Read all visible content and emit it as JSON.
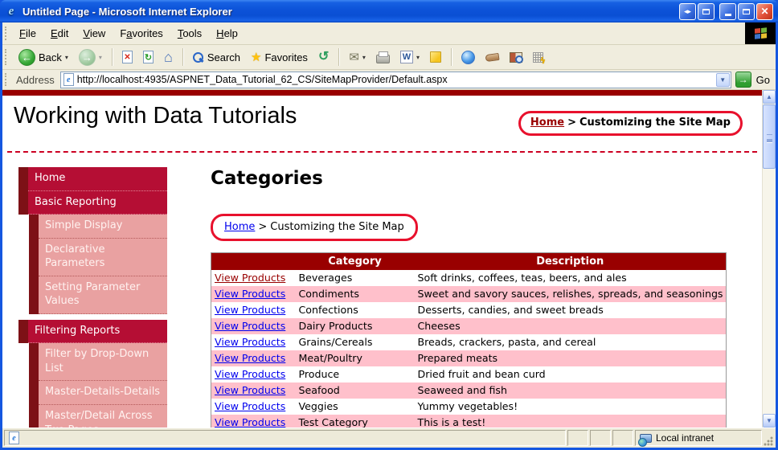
{
  "window": {
    "title": "Untitled Page - Microsoft Internet Explorer"
  },
  "menu_bar": {
    "items": [
      {
        "pre": "",
        "key": "F",
        "post": "ile"
      },
      {
        "pre": "",
        "key": "E",
        "post": "dit"
      },
      {
        "pre": "",
        "key": "V",
        "post": "iew"
      },
      {
        "pre": "F",
        "key": "a",
        "post": "vorites"
      },
      {
        "pre": "",
        "key": "T",
        "post": "ools"
      },
      {
        "pre": "",
        "key": "H",
        "post": "elp"
      }
    ]
  },
  "toolbar": {
    "back_label": "Back",
    "search_label": "Search",
    "favorites_label": "Favorites"
  },
  "address_bar": {
    "label": "Address",
    "url": "http://localhost:4935/ASPNET_Data_Tutorial_62_CS/SiteMapProvider/Default.aspx",
    "go_label": "Go"
  },
  "icons": {
    "back_arrow": "←",
    "forward_arrow": "→",
    "dropdown": "▾",
    "stop": "✕",
    "refresh": "↻",
    "home": "⌂",
    "star": "★",
    "history": "↺",
    "mail": "✉",
    "word": "W",
    "lightning": "ϟ",
    "up": "▲",
    "down": "▼",
    "close": "✕",
    "resize_h": "◂▸",
    "go_arrow": "→",
    "ie_e": "e"
  },
  "page": {
    "header_title": "Working with Data Tutorials",
    "top_breadcrumb": {
      "home": "Home",
      "sep": ">",
      "current": "Customizing the Site Map"
    },
    "sidebar": {
      "items": [
        {
          "label": "Home",
          "level": 1
        },
        {
          "label": "Basic Reporting",
          "level": 1
        },
        {
          "label": "Simple Display",
          "level": 2
        },
        {
          "label": "Declarative Parameters",
          "level": 2
        },
        {
          "label": "Setting Parameter Values",
          "level": 2
        },
        {
          "label": "Filtering Reports",
          "level": 1,
          "gap_before": true
        },
        {
          "label": "Filter by Drop-Down List",
          "level": 2
        },
        {
          "label": "Master-Details-Details",
          "level": 2
        },
        {
          "label": "Master/Detail Across Two Pages",
          "level": 2
        },
        {
          "label": "",
          "level": 2,
          "cut": true
        }
      ]
    },
    "main": {
      "title": "Categories",
      "breadcrumb": {
        "home": "Home",
        "sep": ">",
        "current": "Customizing the Site Map"
      },
      "table": {
        "headers": [
          "",
          "Category",
          "Description"
        ],
        "link_label": "View Products",
        "rows": [
          {
            "category": "Beverages",
            "description": "Soft drinks, coffees, teas, beers, and ales",
            "visited": true
          },
          {
            "category": "Condiments",
            "description": "Sweet and savory sauces, relishes, spreads, and seasonings"
          },
          {
            "category": "Confections",
            "description": "Desserts, candies, and sweet breads"
          },
          {
            "category": "Dairy Products",
            "description": "Cheeses"
          },
          {
            "category": "Grains/Cereals",
            "description": "Breads, crackers, pasta, and cereal"
          },
          {
            "category": "Meat/Poultry",
            "description": "Prepared meats"
          },
          {
            "category": "Produce",
            "description": "Dried fruit and bean curd"
          },
          {
            "category": "Seafood",
            "description": "Seaweed and fish"
          },
          {
            "category": "Veggies",
            "description": "Yummy vegetables!"
          },
          {
            "category": "Test Category",
            "description": "This is a test!"
          }
        ]
      }
    }
  },
  "status_bar": {
    "zone_text": "Local intranet"
  },
  "colors": {
    "maroon": "#990000",
    "nav_crimson": "#B50E34",
    "nav_strip": "#7D1116",
    "nav_sub_pink": "#E9A1A1",
    "row_pink": "#FFC0CB",
    "annotation_red": "#E8112D",
    "link_blue": "#0000EE",
    "link_visited": "#990000",
    "chrome_beige": "#F0EDDE",
    "titlebar_blue": "#0C52D8"
  }
}
